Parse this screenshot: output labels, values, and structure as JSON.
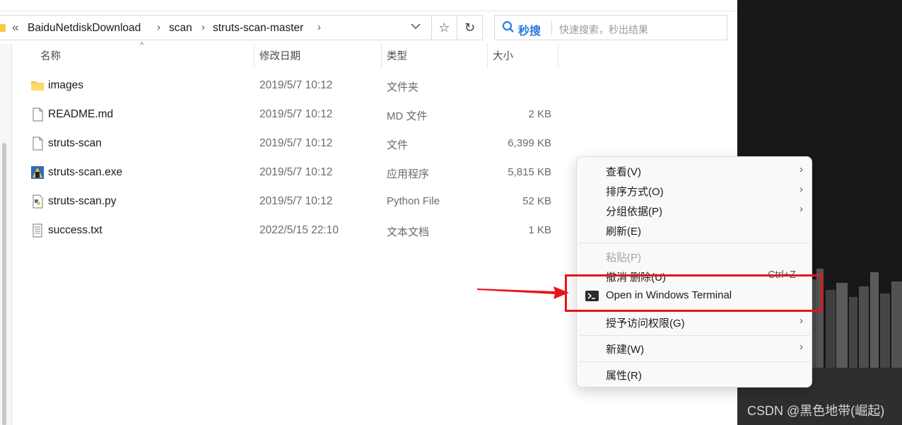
{
  "address_bar": {
    "overflow_glyph": "«",
    "crumbs": [
      "BaiduNetdiskDownload",
      "scan",
      "struts-scan-master"
    ],
    "dropdown_glyph": "⌵"
  },
  "toolbar": {
    "favorite_glyph": "☆",
    "refresh_glyph": "↻"
  },
  "search": {
    "brand": "秒搜",
    "placeholder": "快速搜索，秒出结果"
  },
  "columns": [
    "名称",
    "修改日期",
    "类型",
    "大小"
  ],
  "files": [
    {
      "name": "images",
      "date": "2019/5/7 10:12",
      "type": "文件夹",
      "size": "",
      "icon": "folder-icon"
    },
    {
      "name": "README.md",
      "date": "2019/5/7 10:12",
      "type": "MD 文件",
      "size": "2 KB",
      "icon": "document-icon"
    },
    {
      "name": "struts-scan",
      "date": "2019/5/7 10:12",
      "type": "文件",
      "size": "6,399 KB",
      "icon": "document-icon"
    },
    {
      "name": "struts-scan.exe",
      "date": "2019/5/7 10:12",
      "type": "应用程序",
      "size": "5,815 KB",
      "icon": "exe-icon"
    },
    {
      "name": "struts-scan.py",
      "date": "2019/5/7 10:12",
      "type": "Python File",
      "size": "52 KB",
      "icon": "python-icon"
    },
    {
      "name": "success.txt",
      "date": "2022/5/15 22:10",
      "type": "文本文档",
      "size": "1 KB",
      "icon": "text-file-icon"
    }
  ],
  "context_menu": {
    "items": [
      {
        "label": "查看(V)",
        "submenu": true
      },
      {
        "label": "排序方式(O)",
        "submenu": true
      },
      {
        "label": "分组依据(P)",
        "submenu": true
      },
      {
        "label": "刷新(E)"
      },
      {
        "label": "粘贴(P)",
        "disabled": true
      },
      {
        "label": "撤消 删除(U)",
        "shortcut": "Ctrl+Z"
      },
      {
        "label": "Open in Windows Terminal",
        "icon": "terminal-icon"
      },
      {
        "label": "授予访问权限(G)",
        "submenu": true
      },
      {
        "label": "新建(W)",
        "submenu": true
      },
      {
        "label": "属性(R)"
      }
    ],
    "chevron": "›"
  },
  "watermark": "CSDN @黑色地带(崛起)",
  "colors": {
    "highlight": "#e8141b",
    "search_brand": "#2a7ae2",
    "folder": "#f7c948"
  }
}
